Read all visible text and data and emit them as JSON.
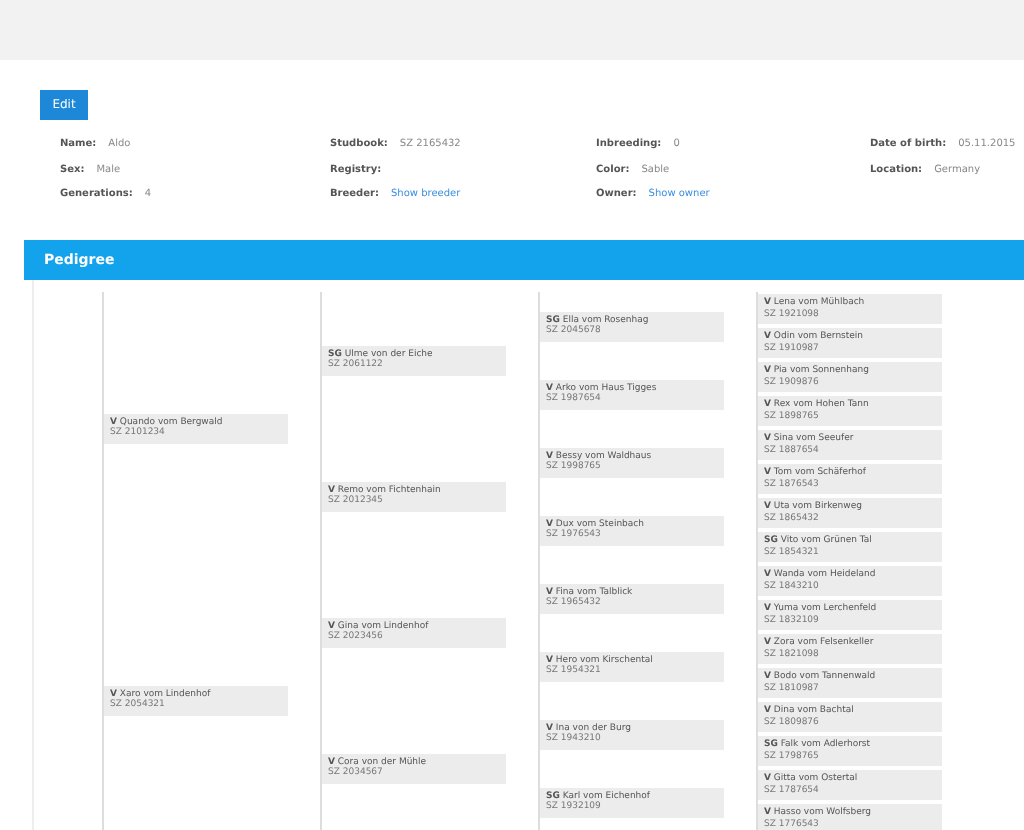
{
  "toolbar": {
    "button": "Edit"
  },
  "fields": [
    [
      {
        "label": "Name:",
        "value": "Aldo"
      },
      {
        "label": "Sex:",
        "value": "Male"
      },
      {
        "label": "Generations:",
        "value": "4"
      }
    ],
    [
      {
        "label": "Studbook:",
        "value": "SZ 2165432"
      },
      {
        "label": "Registry:"
      },
      {
        "label": "Breeder:",
        "value": "Show breeder",
        "link": true
      }
    ],
    [
      {
        "label": "Inbreeding:",
        "value": "0"
      },
      {
        "label": "Color:",
        "value": "Sable"
      },
      {
        "label": "Owner:",
        "value": "Show owner",
        "link": true
      }
    ],
    [
      {
        "label": "Date of birth:",
        "value": "05.11.2015"
      },
      {
        "label": "Location:",
        "value": "Germany"
      }
    ]
  ],
  "section": {
    "title": "Pedigree"
  },
  "tree": [
    {
      "name": "**V** Quando vom Bergwald",
      "info": "SZ 2101234"
    },
    {
      "name": "**V** Xaro vom Lindenhof",
      "info": "SZ 2054321"
    },
    {
      "name": "**SG** Ulme von der Eiche",
      "info": "SZ 2061122"
    },
    {
      "name": "**V** Remo vom Fichtenhain",
      "info": "SZ 2012345"
    },
    {
      "name": "**V** Gina vom Lindenhof",
      "info": "SZ 2023456"
    },
    {
      "name": "**V** Cora von der Mühle",
      "info": "SZ 2034567"
    },
    {
      "name": "**SG** Ella vom Rosenhag",
      "info": "SZ 2045678"
    },
    {
      "name": "**V** Arko vom Haus Tigges",
      "info": "SZ 1987654"
    },
    {
      "name": "**V** Bessy vom Waldhaus",
      "info": "SZ 1998765"
    },
    {
      "name": "**V** Dux vom Steinbach",
      "info": "SZ 1976543"
    },
    {
      "name": "**V** Fina vom Talblick",
      "info": "SZ 1965432"
    },
    {
      "name": "**V** Hero vom Kirschental",
      "info": "SZ 1954321"
    },
    {
      "name": "**V** Ina von der Burg",
      "info": "SZ 1943210"
    },
    {
      "name": "**SG** Karl vom Eichenhof",
      "info": "SZ 1932109"
    },
    {
      "name": "**V** Lena vom Mühlbach",
      "info": "SZ 1921098"
    },
    {
      "name": "**V** Odin vom Bernstein",
      "info": "SZ 1910987"
    },
    {
      "name": "**V** Pia vom Sonnenhang",
      "info": "SZ 1909876"
    },
    {
      "name": "**V** Rex vom Hohen Tann",
      "info": "SZ 1898765"
    },
    {
      "name": "**V** Sina vom Seeufer",
      "info": "SZ 1887654"
    },
    {
      "name": "**V** Tom vom Schäferhof",
      "info": "SZ 1876543"
    },
    {
      "name": "**V** Uta vom Birkenweg",
      "info": "SZ 1865432"
    },
    {
      "name": "**SG** Vito vom Grünen Tal",
      "info": "SZ 1854321"
    },
    {
      "name": "**V** Wanda vom Heideland",
      "info": "SZ 1843210"
    },
    {
      "name": "**V** Yuma vom Lerchenfeld",
      "info": "SZ 1832109"
    },
    {
      "name": "**V** Zora vom Felsenkeller",
      "info": "SZ 1821098"
    },
    {
      "name": "**V** Bodo vom Tannenwald",
      "info": "SZ 1810987"
    },
    {
      "name": "**V** Dina vom Bachtal",
      "info": "SZ 1809876"
    },
    {
      "name": "**SG** Falk vom Adlerhorst",
      "info": "SZ 1798765"
    },
    {
      "name": "**V** Gitta vom Ostertal",
      "info": "SZ 1787654"
    },
    {
      "name": "**V** Hasso vom Wolfsberg",
      "info": "SZ 1776543"
    }
  ]
}
